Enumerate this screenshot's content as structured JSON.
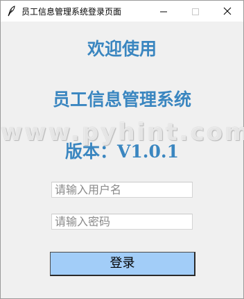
{
  "window": {
    "title": "员工信息管理系统登录页面"
  },
  "main": {
    "welcome": "欢迎使用",
    "system_name": "员工信息管理系统",
    "version": "版本：V1.0.1",
    "watermark": "www.pyhint.com"
  },
  "form": {
    "username_placeholder": "请输入用户名",
    "password_placeholder": "请输入密码",
    "login_label": "登录"
  },
  "colors": {
    "heading": "#3a86c0",
    "button": "#a2cdf8",
    "background": "#f0f0f0"
  },
  "icons": {
    "app": "feather-icon",
    "minimize": "minimize-icon",
    "maximize": "maximize-icon",
    "close": "close-icon"
  }
}
